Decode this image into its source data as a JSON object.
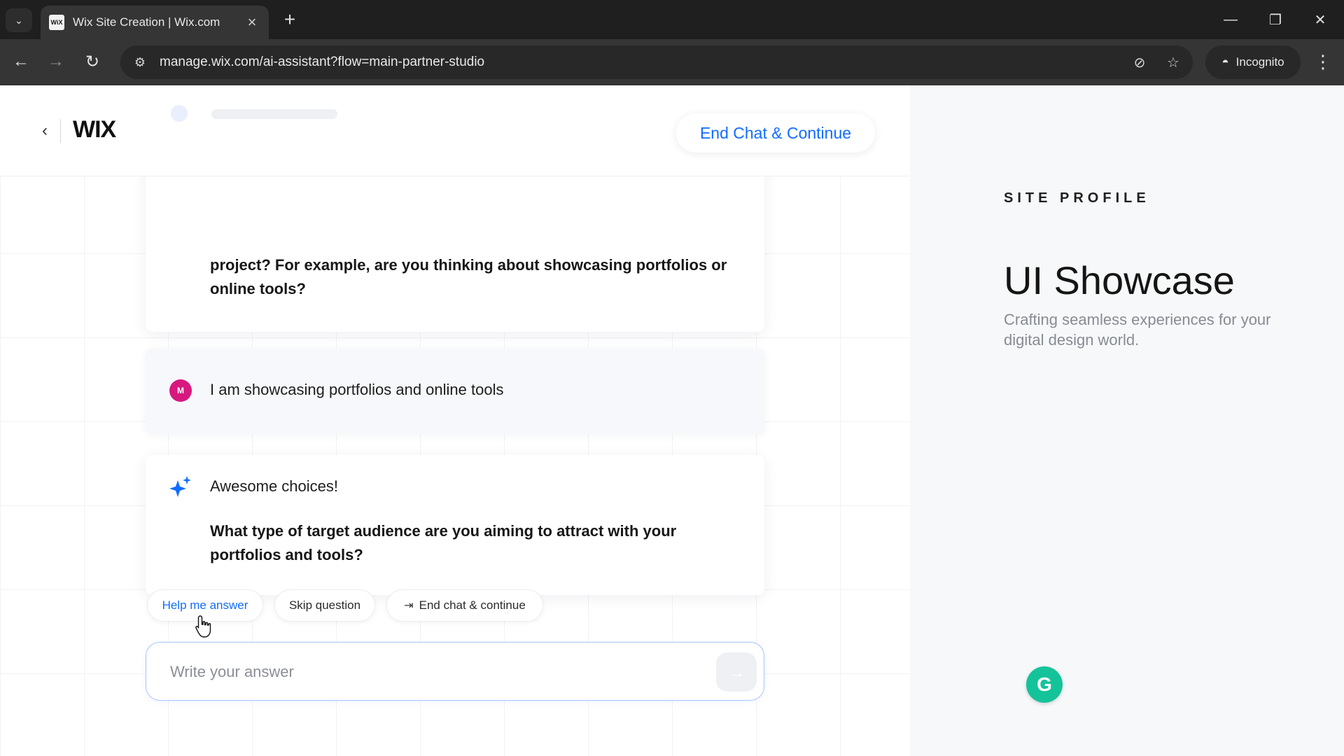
{
  "browser": {
    "tab_title": "Wix Site Creation | Wix.com",
    "favicon_text": "WiX",
    "url": "manage.wix.com/ai-assistant?flow=main-partner-studio",
    "incognito_label": "Incognito"
  },
  "header": {
    "logo": "WIX",
    "end_chat_button": "End Chat & Continue"
  },
  "chat": {
    "question_1": "project? For example, are you thinking about showcasing portfolios or online tools?",
    "user_avatar_initial": "M",
    "user_reply": "I am showcasing portfolios and online tools",
    "ai_intro": "Awesome choices!",
    "question_2": "What type of target audience are you aiming to attract with your portfolios and tools?"
  },
  "actions": {
    "help_me_answer": "Help me answer",
    "skip_question": "Skip question",
    "end_chat_continue": "End chat & continue"
  },
  "input": {
    "placeholder": "Write your answer"
  },
  "site_profile": {
    "label": "SITE PROFILE",
    "title": "UI Showcase",
    "tagline": "Crafting seamless experiences for your digital design world."
  },
  "colors": {
    "accent": "#116dff",
    "user_avatar": "#d6187f",
    "grammarly": "#15c39a"
  }
}
